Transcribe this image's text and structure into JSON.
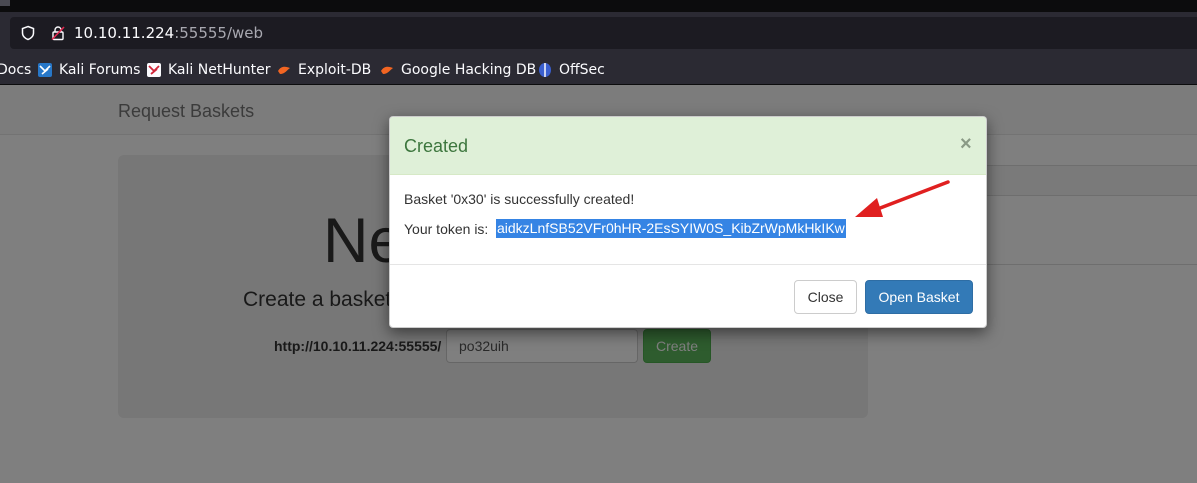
{
  "browser": {
    "url_host": "10.10.11.224",
    "url_rest": ":55555/web",
    "bookmarks": [
      {
        "label": "Docs",
        "icon": "docs-icon"
      },
      {
        "label": "Kali Forums",
        "icon": "kali-forums-icon"
      },
      {
        "label": "Kali NetHunter",
        "icon": "kali-nethunter-icon"
      },
      {
        "label": "Exploit-DB",
        "icon": "exploit-db-icon"
      },
      {
        "label": "Google Hacking DB",
        "icon": "google-hacking-db-icon"
      },
      {
        "label": "OffSec",
        "icon": "offsec-icon"
      }
    ]
  },
  "page": {
    "brand": "Request Baskets",
    "jumbo_title": "Ne",
    "jumbo_subtitle": "Create a basket",
    "url_prefix": "http://10.10.11.224:55555/",
    "basket_name": "po32uih",
    "create_label": "Create"
  },
  "modal": {
    "title": "Created",
    "close_symbol": "×",
    "message": "Basket '0x30' is successfully created!",
    "token_label": "Your token is:",
    "token": "aidkzLnfSB52VFr0hHR-2EsSYIW0S_KibZrWpMkHkIKw",
    "close_label": "Close",
    "open_label": "Open Basket"
  },
  "colors": {
    "header_success_bg": "#dff0d8",
    "title_success": "#3c763d",
    "primary": "#337ab7",
    "create_green": "#5cb85c",
    "selection": "#3584e4",
    "annotation_arrow": "#e02020"
  }
}
